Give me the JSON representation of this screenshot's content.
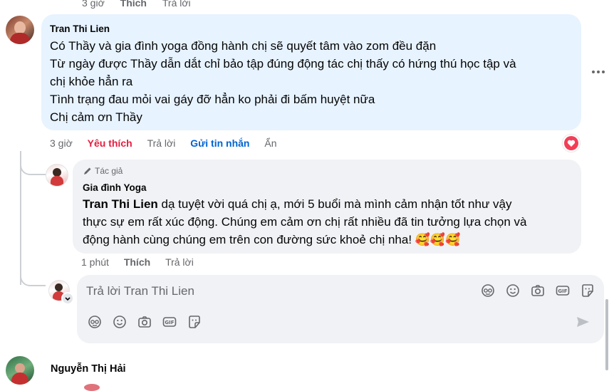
{
  "top_row": {
    "time": "3 giờ",
    "like": "Thích",
    "reply": "Trả lời"
  },
  "comment1": {
    "author": "Tran Thi Lien",
    "lines": [
      "Có Thầy và gia đình yoga đồng hành chị sẽ quyết tâm vào zom đều đặn",
      "Từ ngày được Thầy dẫn dắt chỉ bảo tập đúng động tác chị thấy có hứng thú học tập và",
      "chị khỏe hẳn ra",
      "Tình trạng đau mỏi vai gáy đỡ hẳn ko phải đi bấm huyệt nữa",
      "Chị cảm ơn Thầy"
    ],
    "actions": {
      "time": "3 giờ",
      "liked": "Yêu thích",
      "reply": "Trả lời",
      "message": "Gửi tin nhắn",
      "hide": "Ẩn"
    },
    "more_icon": "more-dots-icon",
    "reaction_icon": "heart-icon",
    "colors": {
      "liked": "#e41e3f",
      "message": "#0064d1",
      "bubble": "#e7f3ff"
    }
  },
  "reply1": {
    "badge": "Tác giả",
    "author": "Gia đình Yoga",
    "mention": "Tran Thi Lien",
    "text_line1": " dạ tuyệt vời quá chị ạ, mới 5 buổi mà mình cảm nhận tốt như vậy",
    "text_line2": "thực sự em rất xúc động. Chúng em cảm ơn chị rất nhiều đã tin tưởng lựa chọn và",
    "text_line3": "động hành cùng chúng em trên con đường sức khoẻ chị nha! 🥰🥰🥰",
    "actions": {
      "time": "1 phút",
      "like": "Thích",
      "reply": "Trả lời"
    }
  },
  "reply_box": {
    "placeholder": "Trả lời Tran Thi Lien",
    "icons_top": [
      "avatar-sticker-icon",
      "emoji-icon",
      "camera-icon",
      "gif-icon",
      "sticker-icon"
    ],
    "icons_bottom": [
      "avatar-sticker-icon",
      "emoji-icon",
      "camera-icon",
      "gif-icon",
      "sticker-icon"
    ],
    "send_icon": "send-icon"
  },
  "comment2": {
    "author": "Nguyễn Thị Hải"
  }
}
